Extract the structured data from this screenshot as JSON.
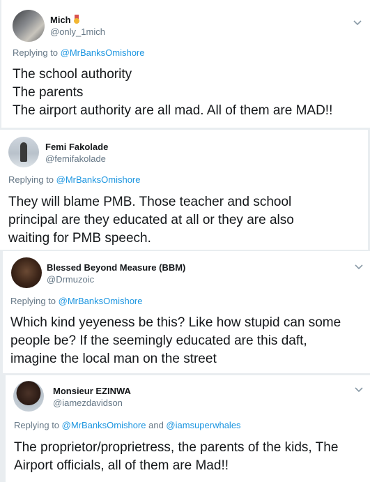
{
  "tweets": [
    {
      "name": "Mich",
      "name_badge": "medal-icon",
      "handle": "@only_1mich",
      "replying_to_prefix": "Replying to ",
      "mentions": [
        "@MrBanksOmishore"
      ],
      "joiner": "",
      "body_lines": [
        "The school authority",
        "The parents",
        "The airport authority are all mad. All of them are MAD!!"
      ]
    },
    {
      "name": "Femi Fakolade",
      "handle": "@femifakolade",
      "replying_to_prefix": "Replying to ",
      "mentions": [
        "@MrBanksOmishore"
      ],
      "joiner": "",
      "body_lines": [
        "They will blame PMB. Those teacher and school",
        "principal are they educated at all or they are also",
        "waiting for PMB speech."
      ]
    },
    {
      "name": "Blessed Beyond Measure (BBM)",
      "handle": "@Drmuzoic",
      "replying_to_prefix": "Replying to ",
      "mentions": [
        "@MrBanksOmishore"
      ],
      "joiner": "",
      "body_lines": [
        "Which kind yeyeness be this? Like how stupid can some",
        "people be? If the seemingly educated are this daft,",
        "imagine the local man on the street"
      ]
    },
    {
      "name": "Monsieur EZINWA",
      "handle": "@iamezdavidson",
      "replying_to_prefix": "Replying to ",
      "mentions": [
        "@MrBanksOmishore",
        "@iamsuperwhales"
      ],
      "joiner": " and ",
      "body_lines": [
        "The proprietor/proprietress, the parents of the kids, The",
        "Airport officials, all of them are Mad!!"
      ]
    }
  ],
  "colors": {
    "link": "#1b95e0",
    "secondary": "#657786",
    "text": "#14171a"
  },
  "icons": {
    "more": "chevron-down-icon",
    "badge": "medal-icon"
  }
}
